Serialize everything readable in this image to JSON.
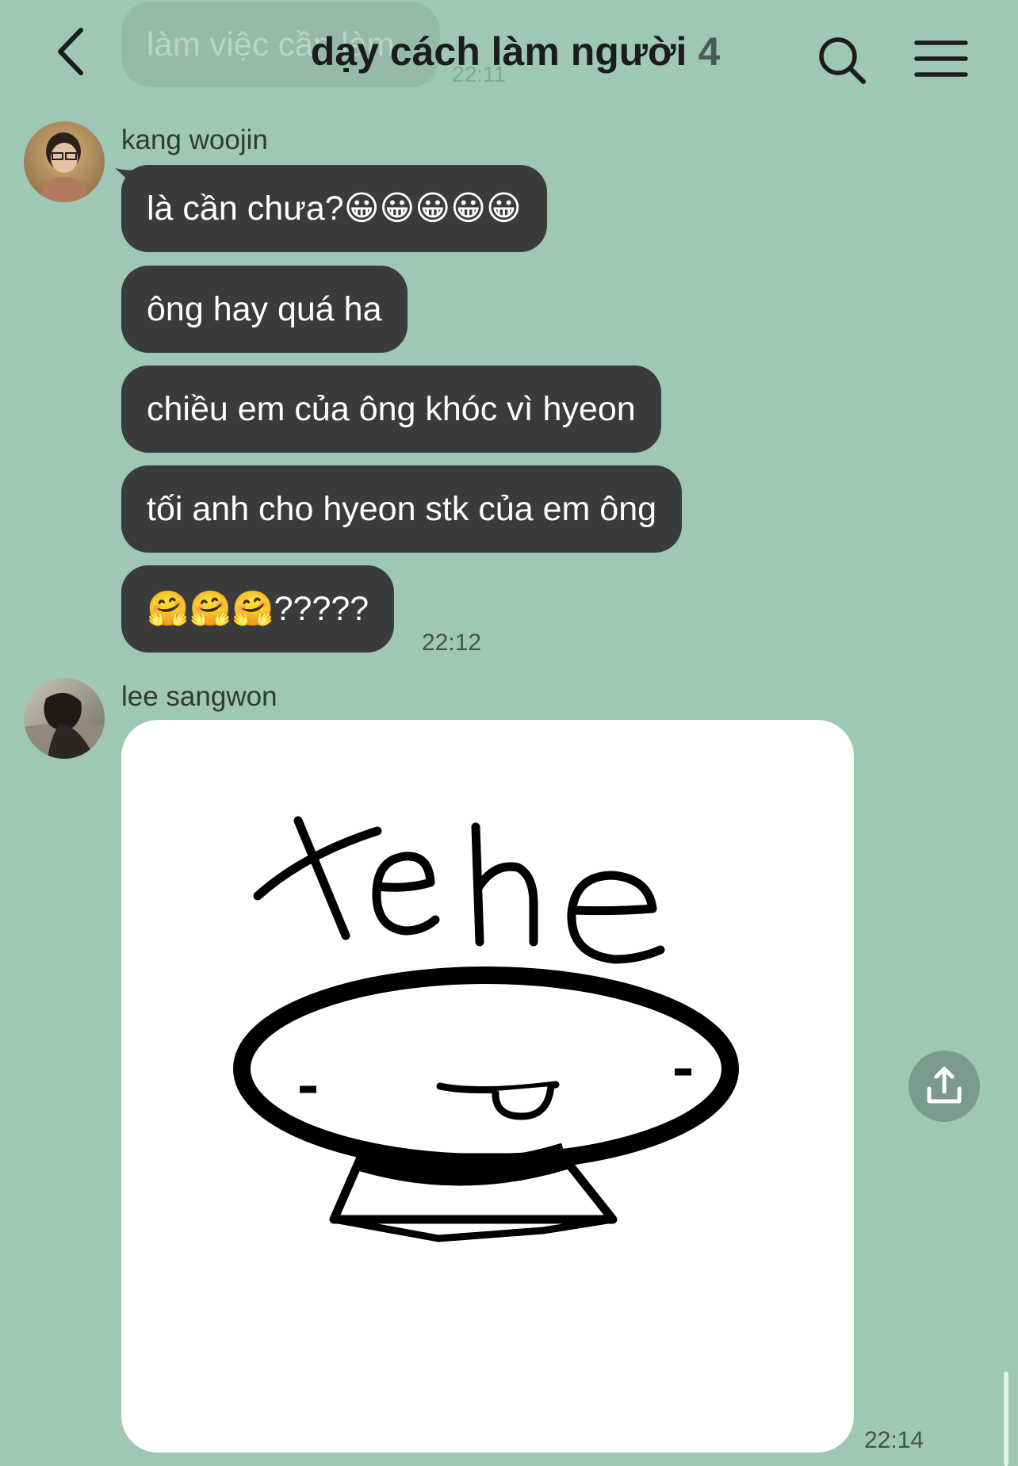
{
  "header": {
    "title": "dạy cách làm người",
    "member_count": "4",
    "back_icon": "chevron-left-icon",
    "search_icon": "search-icon",
    "menu_icon": "hamburger-menu-icon"
  },
  "partial_message": {
    "text": "làm việc cần làm",
    "time": "22:11"
  },
  "messages": {
    "kang": {
      "sender": "kang woojin",
      "bubbles": [
        "là cần chưa?😀😀😀😀😀",
        "ông hay quá ha",
        "chiều em của ông khóc vì hyeon",
        "tối anh cho hyeon stk của em ông",
        "🤗🤗🤗?????"
      ],
      "time": "22:12"
    },
    "lee": {
      "sender": "lee sangwon",
      "sticker_text": "tehe",
      "time": "22:14"
    }
  },
  "share_icon": "share-upload-icon",
  "colors": {
    "background": "#9fc7b6",
    "bubble": "#3a3b3d",
    "bubble_text": "#ffffff"
  }
}
